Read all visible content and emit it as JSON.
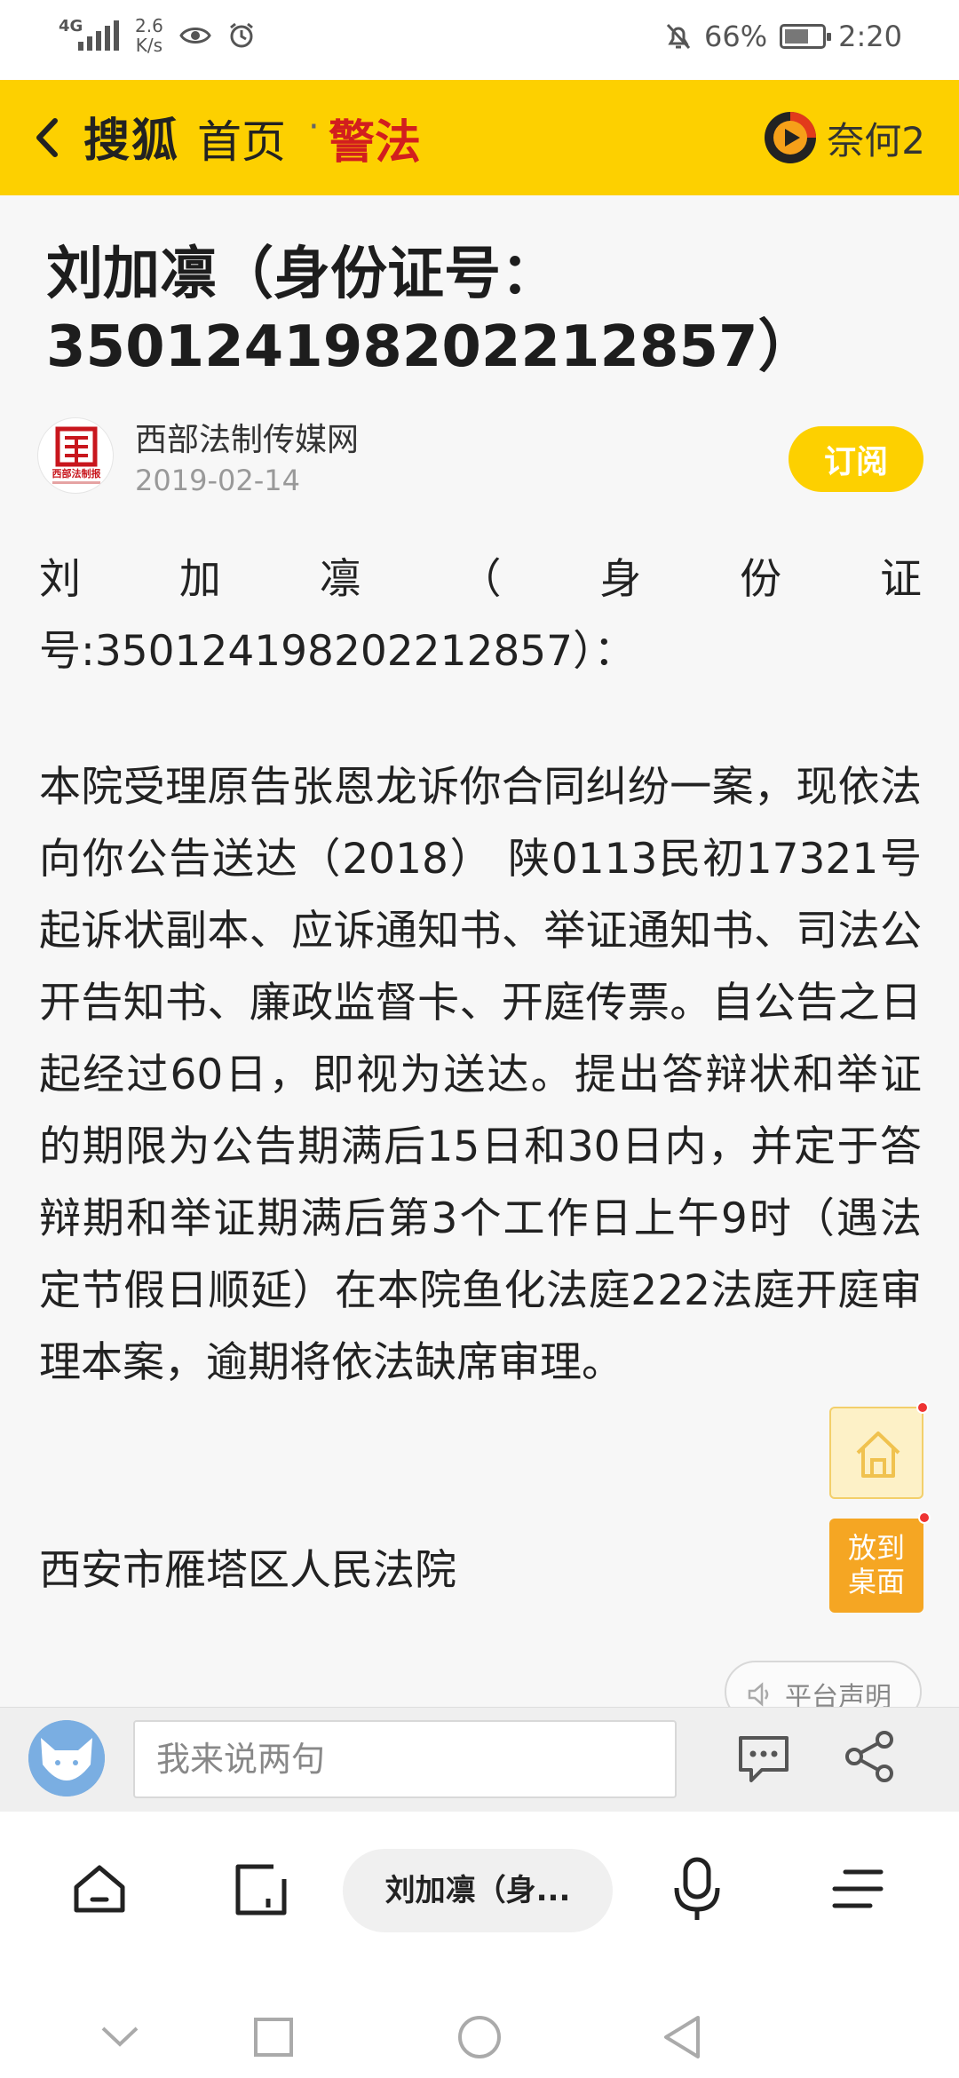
{
  "status_bar": {
    "network": "4G",
    "net_speed_value": "2.6",
    "net_speed_unit": "K/s",
    "battery": "66%",
    "battery_level": 0.66,
    "time": "2:20"
  },
  "header": {
    "brand": "搜狐",
    "home_link": "首页",
    "separator": "·",
    "channel": "警法",
    "user_name": "奈何2"
  },
  "article": {
    "title": "刘加凛（身份证号：350124198202212857）",
    "author": {
      "name": "西部法制传媒网",
      "date": "2019-02-14",
      "logo_text": "西部法制报"
    },
    "subscribe_label": "订阅",
    "salutation_chars": [
      "刘",
      "加",
      "凛",
      "（",
      "身",
      "份",
      "证"
    ],
    "salutation_line2": "号:350124198202212857）：",
    "body": "本院受理原告张恩龙诉你合同纠纷一案，现依法向你公告送达（2018） 陕0113民初17321号起诉状副本、应诉通知书、举证通知书、司法公开告知书、廉政监督卡、开庭传票。自公告之日起经过60日，即视为送达。提出答辩状和举证的期限为公告期满后15日和30日内，并定于答辩期和举证期满后第3个工作日上午9时（遇法定节假日顺延）在本院鱼化法庭222法庭开庭审理本案，逾期将依法缺席审理。",
    "signature": "西安市雁塔区人民法院"
  },
  "floating": {
    "desktop_label_line1": "放到",
    "desktop_label_line2": "桌面",
    "platform_statement": "平台声明"
  },
  "comment_bar": {
    "placeholder": "我来说两句"
  },
  "bottom_nav": {
    "current_tab_label": "刘加凛（身..."
  },
  "colors": {
    "brand_yellow": "#fdd000",
    "channel_red": "#d21e1e",
    "float_orange": "#f5a623"
  }
}
